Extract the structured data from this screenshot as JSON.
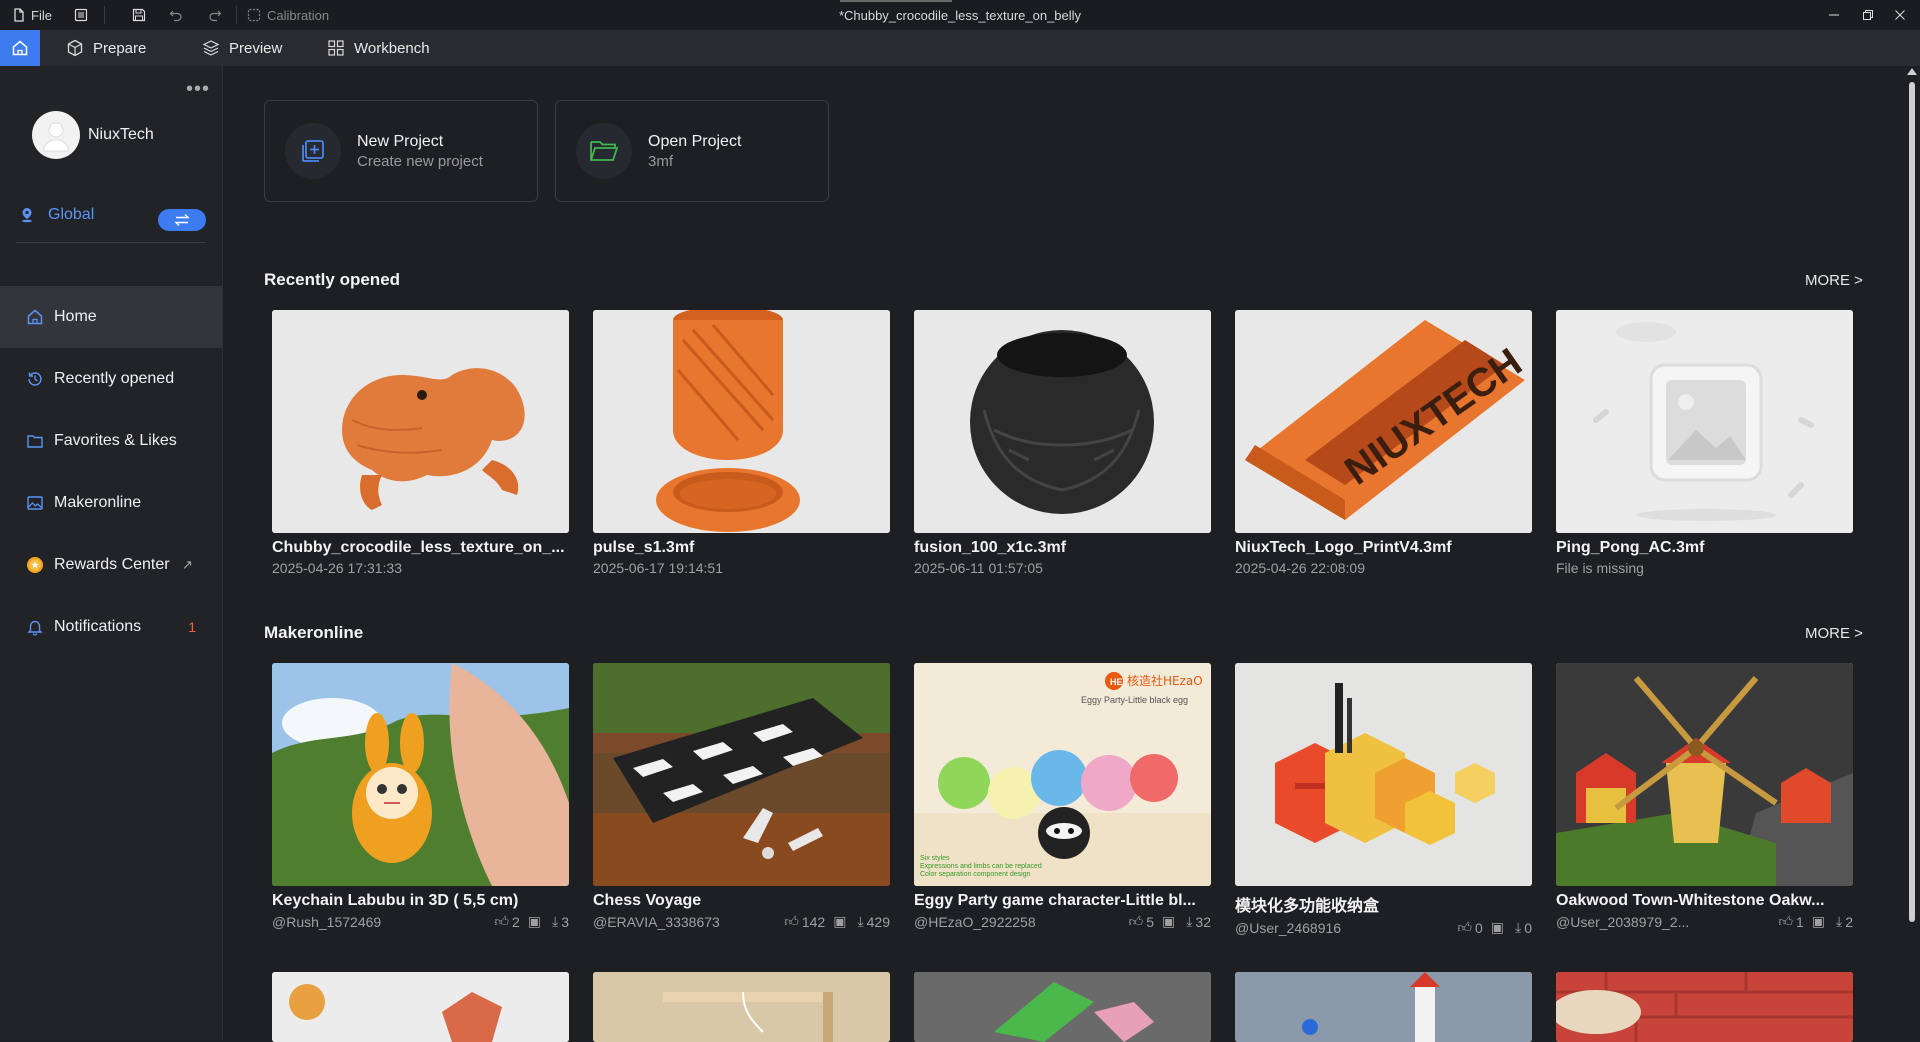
{
  "titlebar": {
    "file_label": "File",
    "calibration_label": "Calibration",
    "document_title": "*Chubby_crocodile_less_texture_on_belly"
  },
  "nav": {
    "tabs": [
      {
        "label": "Prepare",
        "icon": "cube-icon"
      },
      {
        "label": "Preview",
        "icon": "layers-icon"
      },
      {
        "label": "Workbench",
        "icon": "grid-icon"
      }
    ]
  },
  "sidebar": {
    "username": "NiuxTech",
    "region": "Global",
    "items": [
      {
        "label": "Home",
        "icon": "home-icon"
      },
      {
        "label": "Recently opened",
        "icon": "history-icon"
      },
      {
        "label": "Favorites & Likes",
        "icon": "folder-icon"
      },
      {
        "label": "Makeronline",
        "icon": "image-icon"
      },
      {
        "label": "Rewards Center",
        "icon": "coin-icon"
      },
      {
        "label": "Notifications",
        "icon": "bell-icon",
        "badge": "1"
      }
    ]
  },
  "projects": {
    "new": {
      "title": "New Project",
      "subtitle": "Create new project"
    },
    "open": {
      "title": "Open Project",
      "subtitle": "3mf"
    }
  },
  "recent": {
    "title": "Recently opened",
    "more": "MORE >",
    "items": [
      {
        "name": "Chubby_crocodile_less_texture_on_...",
        "date": "2025-04-26 17:31:33"
      },
      {
        "name": "pulse_s1.3mf",
        "date": "2025-06-17 19:14:51"
      },
      {
        "name": "fusion_100_x1c.3mf",
        "date": "2025-06-11 01:57:05"
      },
      {
        "name": "NiuxTech_Logo_PrintV4.3mf",
        "date": "2025-04-26 22:08:09"
      },
      {
        "name": "Ping_Pong_AC.3mf",
        "date": "File is missing"
      }
    ]
  },
  "makeronline": {
    "title": "Makeronline",
    "more": "MORE >",
    "items": [
      {
        "name": "Keychain Labubu in 3D ( 5,5 cm)",
        "author": "@Rush_1572469",
        "likes": "2",
        "collects": "",
        "downloads": "3"
      },
      {
        "name": "Chess Voyage",
        "author": "@ERAVIA_3338673",
        "likes": "142",
        "collects": "",
        "downloads": "429"
      },
      {
        "name": "Eggy Party game character-Little bl...",
        "author": "@HEzaO_2922258",
        "likes": "5",
        "collects": "",
        "downloads": "32"
      },
      {
        "name": "模块化多功能收纳盒",
        "author": "@User_2468916",
        "likes": "0",
        "collects": "",
        "downloads": "0"
      },
      {
        "name": "Oakwood Town-Whitestone Oakw...",
        "author": "@User_2038979_2...",
        "likes": "1",
        "collects": "",
        "downloads": "2"
      }
    ],
    "eggy_banner_brand": "核造社HEzaO",
    "eggy_banner_caption": "Eggy Party-Little black egg",
    "eggy_banner_notes": "Six styles\nExpressions and limbs can be replaced\nColor separation component design"
  }
}
